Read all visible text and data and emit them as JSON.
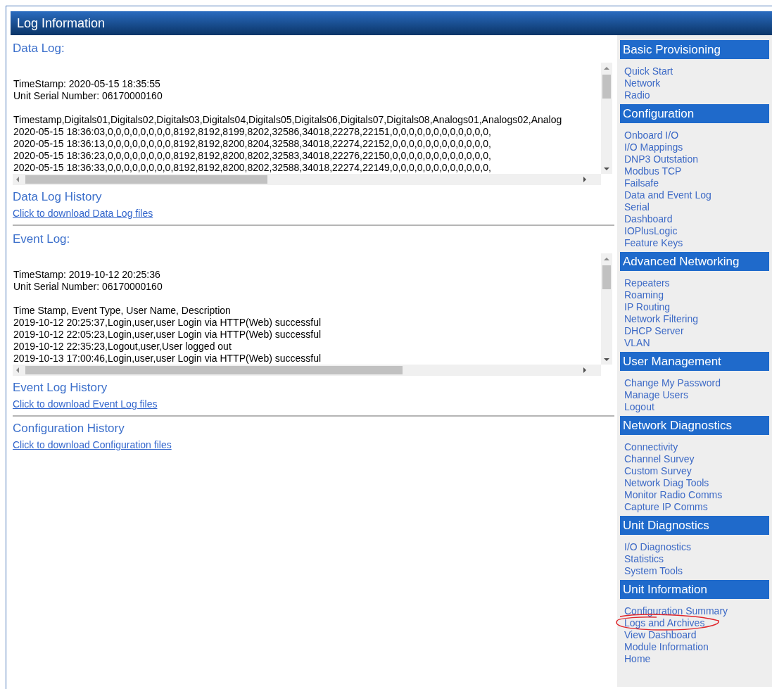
{
  "header": {
    "title": "Log Information"
  },
  "sections": [
    {
      "kind": "log",
      "title": "Data Log:",
      "blocks": [
        [
          "TimeStamp: 2020-05-15 18:35:55",
          "Unit Serial Number: 06170000160"
        ],
        [
          "Timestamp,Digitals01,Digitals02,Digitals03,Digitals04,Digitals05,Digitals06,Digitals07,Digitals08,Analogs01,Analogs02,Analog",
          "2020-05-15 18:36:03,0,0,0,0,0,0,0,0,8192,8192,8199,8202,32586,34018,22278,22151,0,0,0,0,0,0,0,0,0,0,0,0,",
          "2020-05-15 18:36:13,0,0,0,0,0,0,0,0,8192,8192,8200,8204,32588,34018,22274,22152,0,0,0,0,0,0,0,0,0,0,0,0,",
          "2020-05-15 18:36:23,0,0,0,0,0,0,0,0,8192,8192,8200,8202,32583,34018,22276,22150,0,0,0,0,0,0,0,0,0,0,0,0,",
          "2020-05-15 18:36:33,0,0,0,0,0,0,0,0,8192,8192,8200,8202,32588,34018,22274,22149,0,0,0,0,0,0,0,0,0,0,0,0,"
        ]
      ]
    },
    {
      "kind": "download",
      "title": "Data Log History",
      "link": "Click to download Data Log files",
      "divider_below": true
    },
    {
      "kind": "log",
      "title": "Event Log:",
      "blocks": [
        [
          "TimeStamp: 2019-10-12 20:25:36",
          "Unit Serial Number: 06170000160"
        ],
        [
          "Time Stamp, Event Type, User Name, Description",
          "2019-10-12 20:25:37,Login,user,user Login via HTTP(Web) successful",
          "2019-10-12 22:05:23,Login,user,user Login via HTTP(Web) successful",
          "2019-10-12 22:35:23,Logout,user,User logged out",
          "2019-10-13 17:00:46,Login,user,user Login via HTTP(Web) successful"
        ]
      ]
    },
    {
      "kind": "download",
      "title": "Event Log History",
      "link": "Click to download Event Log files",
      "divider_below": true
    },
    {
      "kind": "download",
      "title": "Configuration History",
      "link": "Click to download Configuration files",
      "divider_below": false
    }
  ],
  "sidebar": [
    {
      "heading": "Basic Provisioning",
      "items": [
        {
          "label": "Quick Start",
          "circled": false
        },
        {
          "label": "Network",
          "circled": false
        },
        {
          "label": "Radio",
          "circled": false
        }
      ]
    },
    {
      "heading": "Configuration",
      "items": [
        {
          "label": "Onboard I/O",
          "circled": false
        },
        {
          "label": "I/O Mappings",
          "circled": false
        },
        {
          "label": "DNP3 Outstation",
          "circled": false
        },
        {
          "label": "Modbus TCP",
          "circled": false
        },
        {
          "label": "Failsafe",
          "circled": false
        },
        {
          "label": "Data and Event Log",
          "circled": false
        },
        {
          "label": "Serial",
          "circled": false
        },
        {
          "label": "Dashboard",
          "circled": false
        },
        {
          "label": "IOPlusLogic",
          "circled": false
        },
        {
          "label": "Feature Keys",
          "circled": false
        }
      ]
    },
    {
      "heading": "Advanced Networking",
      "items": [
        {
          "label": "Repeaters",
          "circled": false
        },
        {
          "label": "Roaming",
          "circled": false
        },
        {
          "label": "IP Routing",
          "circled": false
        },
        {
          "label": "Network Filtering",
          "circled": false
        },
        {
          "label": "DHCP Server",
          "circled": false
        },
        {
          "label": "VLAN",
          "circled": false
        }
      ]
    },
    {
      "heading": "User Management",
      "items": [
        {
          "label": "Change My Password",
          "circled": false
        },
        {
          "label": "Manage Users",
          "circled": false
        },
        {
          "label": "Logout",
          "circled": false
        }
      ]
    },
    {
      "heading": "Network Diagnostics",
      "items": [
        {
          "label": "Connectivity",
          "circled": false
        },
        {
          "label": "Channel Survey",
          "circled": false
        },
        {
          "label": "Custom Survey",
          "circled": false
        },
        {
          "label": "Network Diag Tools",
          "circled": false
        },
        {
          "label": "Monitor Radio Comms",
          "circled": false
        },
        {
          "label": "Capture IP Comms",
          "circled": false
        }
      ]
    },
    {
      "heading": "Unit Diagnostics",
      "items": [
        {
          "label": "I/O Diagnostics",
          "circled": false
        },
        {
          "label": "Statistics",
          "circled": false
        },
        {
          "label": "System Tools",
          "circled": false
        }
      ]
    },
    {
      "heading": "Unit Information",
      "items": [
        {
          "label": "Configuration Summary",
          "circled": false
        },
        {
          "label": "Logs and Archives",
          "circled": true
        },
        {
          "label": "View Dashboard",
          "circled": false
        },
        {
          "label": "Module Information",
          "circled": false
        },
        {
          "label": "Home",
          "circled": false
        }
      ]
    }
  ]
}
